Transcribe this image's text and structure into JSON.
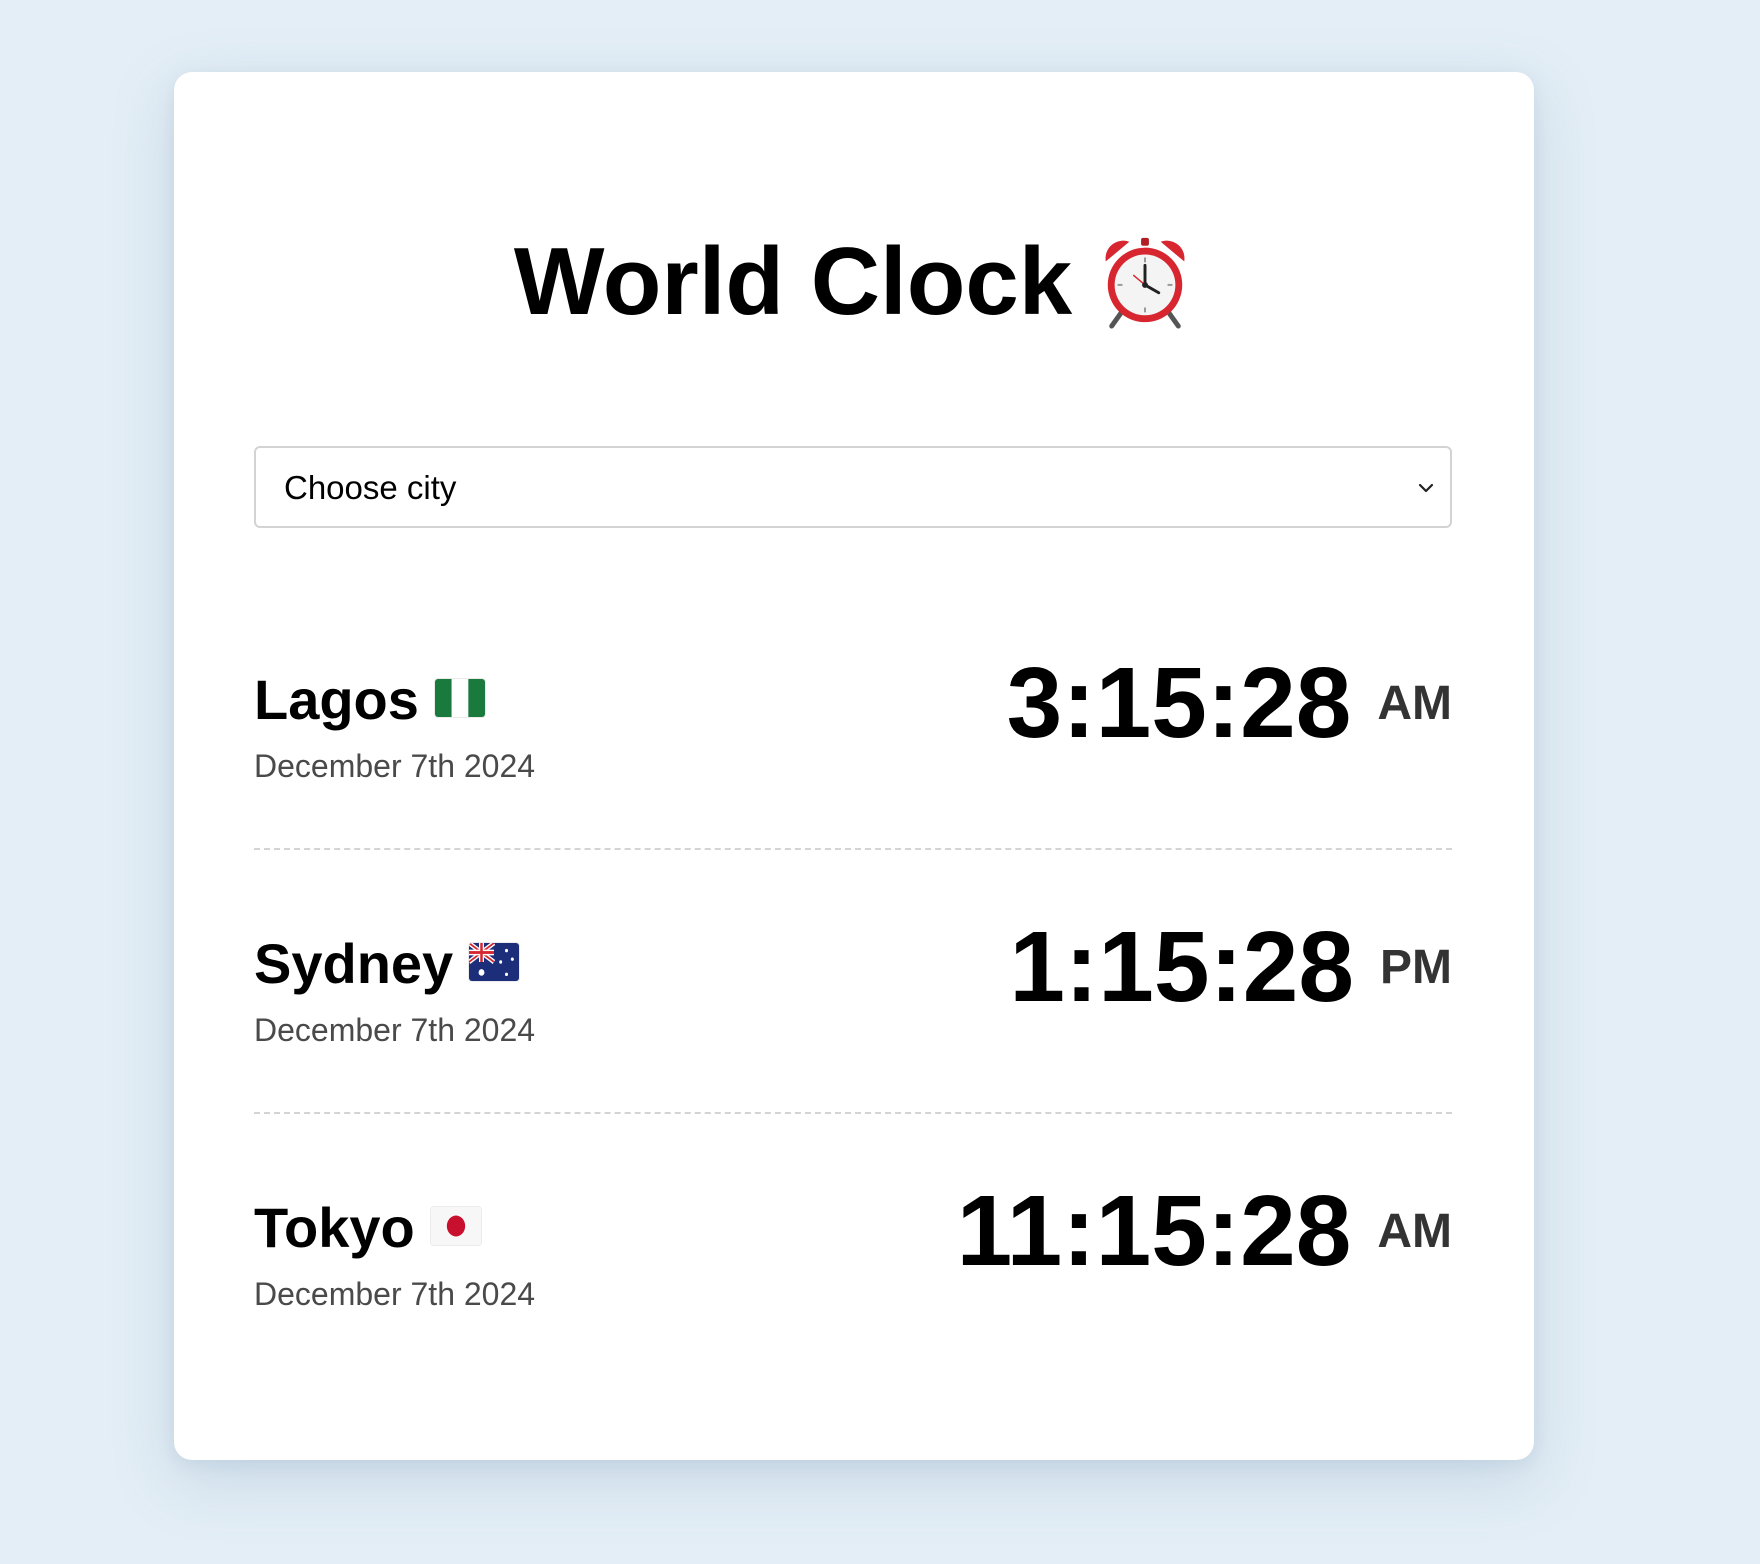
{
  "header": {
    "title": "World Clock"
  },
  "icons": {
    "title_icon": "alarm-clock-icon"
  },
  "city_select": {
    "value": "Choose city"
  },
  "cities": [
    {
      "name": "Lagos",
      "flag": "nigeria-flag-icon",
      "date": "December 7th 2024",
      "time": "3:15:28",
      "ampm": "AM"
    },
    {
      "name": "Sydney",
      "flag": "australia-flag-icon",
      "date": "December 7th 2024",
      "time": "1:15:28",
      "ampm": "PM"
    },
    {
      "name": "Tokyo",
      "flag": "japan-flag-icon",
      "date": "December 7th 2024",
      "time": "11:15:28",
      "ampm": "AM"
    }
  ],
  "colors": {
    "background": "#e3eef6",
    "card": "#ffffff",
    "date_text": "#4a4a4a",
    "ampm_text": "#333333"
  }
}
